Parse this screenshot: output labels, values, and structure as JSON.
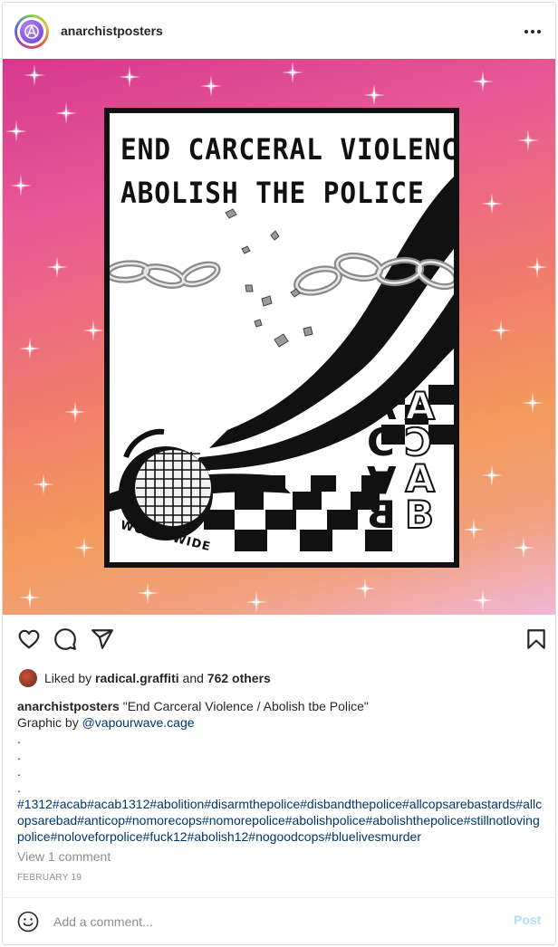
{
  "post": {
    "username": "anarchistposters",
    "poster_title_line1": "END CARCERAL VIOLENCE",
    "poster_title_line2": "ABOLISH THE POLICE",
    "poster_text_worldwide": "WORLDWIDE",
    "poster_acab_letters": [
      "A",
      "A",
      "C",
      "C",
      "A",
      "A",
      "B",
      "B"
    ]
  },
  "likes": {
    "prefix": "Liked by",
    "user": "radical.graffiti",
    "middle": "and",
    "count_text": "762 others"
  },
  "caption": {
    "username": "anarchistposters",
    "text": " \"End Carceral Violence / Abolish tbe Police\"",
    "credit_prefix": "Graphic by ",
    "credit_handle": "@vapourwave.cage",
    "dots": [
      ".",
      ".",
      ".",
      "."
    ],
    "hashtags": "#1312#acab#acab1312#abolition#disarmthepolice#disbandthepolice#allcopsarebastards#allcopsarebad#anticop#nomorecops#nomorepolice#abolishpolice#abolishthepolice#stillnotlovingpolice#noloveforpolice#fuck12#abolish12#nogoodcops#bluelivesmurder"
  },
  "comments": {
    "view_label": "View 1 comment"
  },
  "date": "FEBRUARY 19",
  "comment_box": {
    "placeholder": "Add a comment...",
    "post_label": "Post"
  },
  "icons": {
    "like": "heart-icon",
    "comment": "comment-icon",
    "share": "share-icon",
    "save": "bookmark-icon",
    "more": "more-options-icon",
    "emoji": "emoji-icon"
  },
  "colors": {
    "link": "#00376b",
    "muted": "#8e8e8e",
    "post_disabled": "#b2dffc"
  }
}
